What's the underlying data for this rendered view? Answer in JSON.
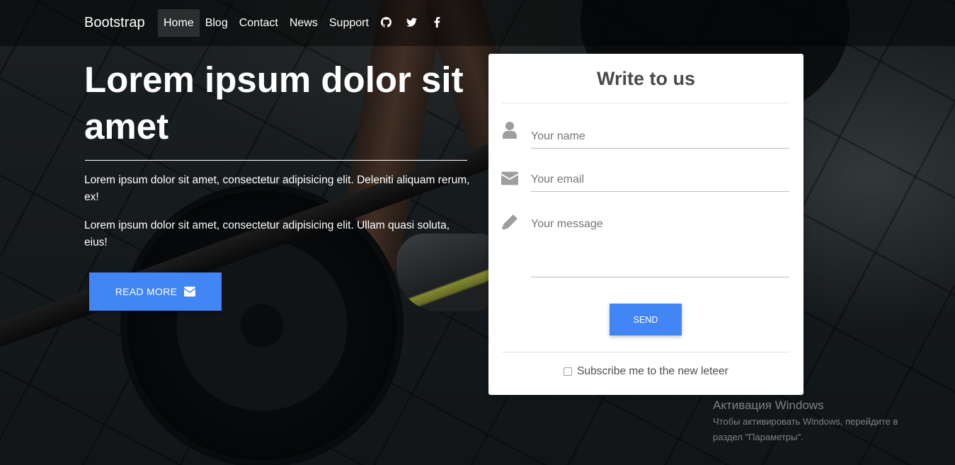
{
  "navbar": {
    "brand": "Bootstrap",
    "links": [
      {
        "label": "Home",
        "active": true
      },
      {
        "label": "Blog"
      },
      {
        "label": "Contact"
      },
      {
        "label": "News"
      },
      {
        "label": "Support"
      }
    ],
    "social_icons": [
      "github-icon",
      "twitter-icon",
      "facebook-icon"
    ]
  },
  "hero": {
    "title": "Lorem ipsum dolor sit amet",
    "paragraph_1": "Lorem ipsum dolor sit amet, consectetur adipisicing elit. Deleniti aliquam rerum, ex!",
    "paragraph_2": "Lorem ipsum dolor sit amet, consectetur adipisicing elit. Ullam quasi soluta, eius!",
    "button_label": "READ MORE",
    "button_icon": "envelope-icon"
  },
  "form": {
    "title": "Write to us",
    "name": {
      "placeholder": "Your name",
      "value": "",
      "icon": "user-icon"
    },
    "email": {
      "placeholder": "Your email",
      "value": "",
      "icon": "envelope-icon"
    },
    "message": {
      "placeholder": "Your message",
      "value": "",
      "icon": "pencil-icon"
    },
    "send_label": "SEND",
    "subscribe_label": "Subscribe me to the new leteer",
    "subscribe_checked": false
  },
  "colors": {
    "accent": "#4285f4",
    "navbar_bg": "rgba(0,0,0,0.45)",
    "card_bg": "#ffffff",
    "text_dark": "#4f4f4f"
  },
  "watermark": {
    "line1": "Активация Windows",
    "line2": "Чтобы активировать Windows, перейдите в",
    "line3": "раздел \"Параметры\"."
  }
}
